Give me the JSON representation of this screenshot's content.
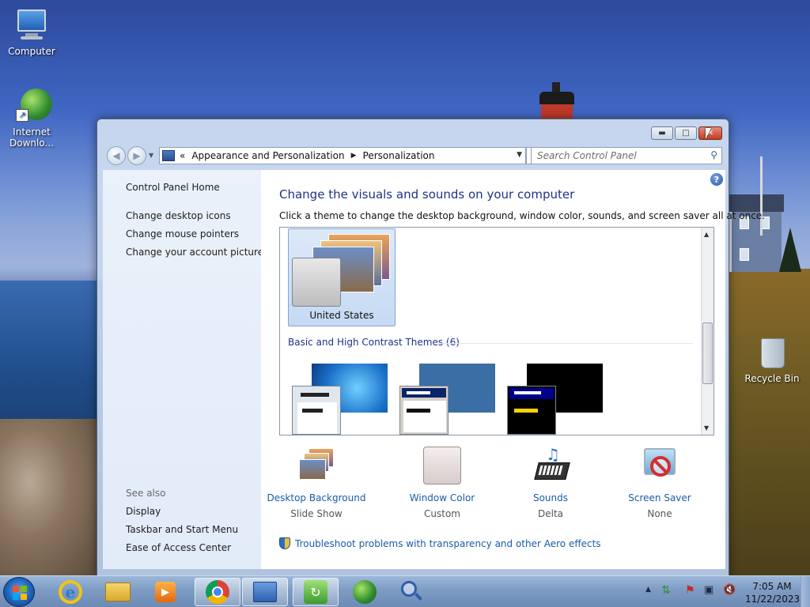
{
  "desktop": {
    "icons": [
      {
        "label": "Computer"
      },
      {
        "label": "Internet Downlo..."
      },
      {
        "label": "Recycle Bin"
      }
    ]
  },
  "window": {
    "breadcrumb": {
      "chevron": "«",
      "level1": "Appearance and Personalization",
      "level2": "Personalization"
    },
    "search_placeholder": "Search Control Panel",
    "left_pane": {
      "home": "Control Panel Home",
      "links": [
        "Change desktop icons",
        "Change mouse pointers",
        "Change your account picture"
      ],
      "see_also_label": "See also",
      "see_also": [
        "Display",
        "Taskbar and Start Menu",
        "Ease of Access Center"
      ]
    },
    "main": {
      "title": "Change the visuals and sounds on your computer",
      "subtitle": "Click a theme to change the desktop background, window color, sounds, and screen saver all at once.",
      "selected_theme": "United States",
      "group_title": "Basic and High Contrast Themes (6)",
      "settings": [
        {
          "link": "Desktop Background",
          "value": "Slide Show",
          "icon": "desktop-background-icon"
        },
        {
          "link": "Window Color",
          "value": "Custom",
          "icon": "window-color-icon"
        },
        {
          "link": "Sounds",
          "value": "Delta",
          "icon": "sounds-icon"
        },
        {
          "link": "Screen Saver",
          "value": "None",
          "icon": "screen-saver-icon"
        }
      ],
      "troubleshoot": "Troubleshoot problems with transparency and other Aero effects"
    }
  },
  "taskbar": {
    "clock_time": "7:05 AM",
    "clock_date": "11/22/2023",
    "colors": {
      "accent": "#1e3287",
      "link": "#1a5ca8"
    }
  }
}
